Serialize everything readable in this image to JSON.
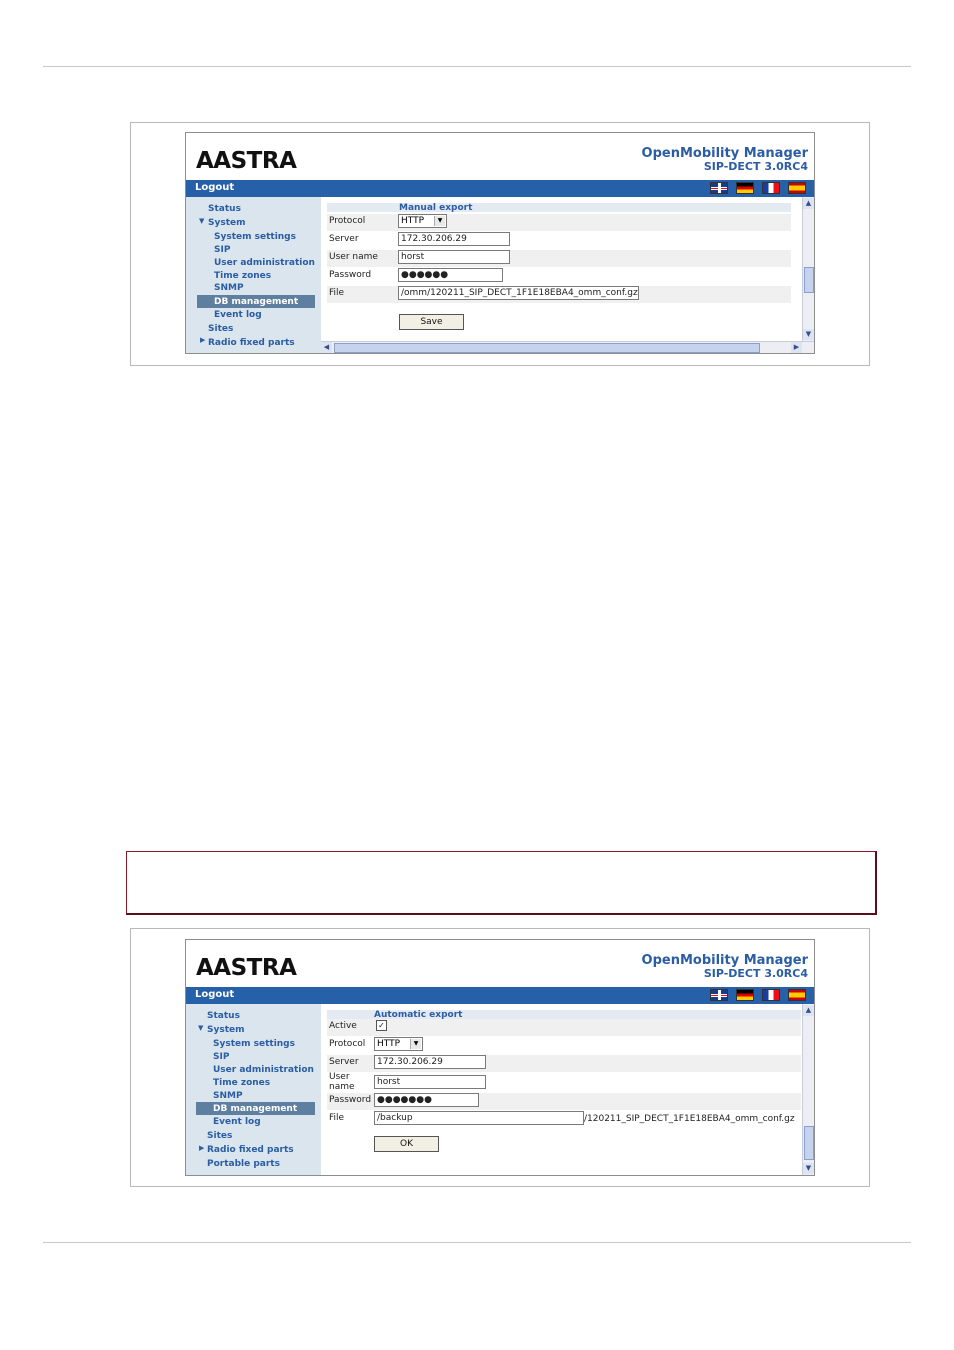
{
  "screens": [
    {
      "brand": "AASTRA",
      "app_title": "OpenMobility Manager",
      "app_version": "SIP-DECT 3.0RC4",
      "logout_label": "Logout",
      "flags": [
        "uk-flag-icon",
        "de-flag-icon",
        "fr-flag-icon",
        "es-flag-icon"
      ],
      "nav": {
        "status": "Status",
        "system": "System",
        "system_settings": "System settings",
        "sip": "SIP",
        "user_admin": "User administration",
        "time_zones": "Time zones",
        "snmp": "SNMP",
        "db_management": "DB management",
        "event_log": "Event log",
        "sites": "Sites",
        "radio_fixed_parts": "Radio fixed parts"
      },
      "section_title": "Manual export",
      "form": {
        "protocol_label": "Protocol",
        "protocol_value": "HTTP",
        "server_label": "Server",
        "server_value": "172.30.206.29",
        "username_label": "User name",
        "username_value": "horst",
        "password_label": "Password",
        "password_value": "●●●●●●",
        "file_label": "File",
        "file_value": "/omm/120211_SIP_DECT_1F1E18EBA4_omm_conf.gz",
        "submit_label": "Save"
      }
    },
    {
      "brand": "AASTRA",
      "app_title": "OpenMobility Manager",
      "app_version": "SIP-DECT 3.0RC4",
      "logout_label": "Logout",
      "nav": {
        "status": "Status",
        "system": "System",
        "system_settings": "System settings",
        "sip": "SIP",
        "user_admin": "User administration",
        "time_zones": "Time zones",
        "snmp": "SNMP",
        "db_management": "DB management",
        "event_log": "Event log",
        "sites": "Sites",
        "radio_fixed_parts": "Radio fixed parts",
        "portable_parts": "Portable parts"
      },
      "section_title": "Automatic export",
      "form": {
        "active_label": "Active",
        "active_checked": "✓",
        "protocol_label": "Protocol",
        "protocol_value": "HTTP",
        "server_label": "Server",
        "server_value": "172.30.206.29",
        "username_label_1": "User",
        "username_label_2": "name",
        "username_value": "horst",
        "password_label": "Password",
        "password_value": "●●●●●●●",
        "file_label": "File",
        "file_value": "/backup",
        "file_suffix": "/120211_SIP_DECT_1F1E18EBA4_omm_conf.gz",
        "submit_label": "OK"
      }
    }
  ],
  "colors": {
    "header_bar": "#2560a8",
    "sidebar": "#dbe5ee",
    "nav_text": "#2a5da3",
    "active_nav": "#5f7fa0",
    "note_border": "#8a1a2a"
  }
}
